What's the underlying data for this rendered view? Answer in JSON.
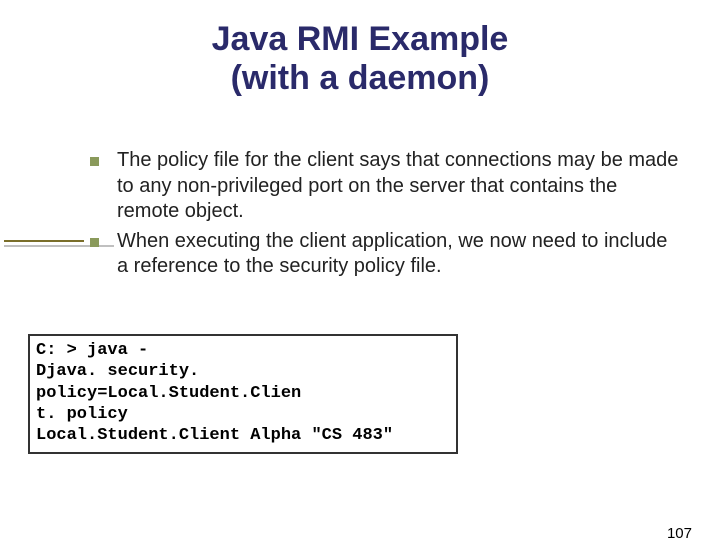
{
  "title_line1": "Java RMI Example",
  "title_line2": "(with a daemon)",
  "bullets": [
    "The policy file for the client says that connections may be made to any non-privileged port on the server that contains the remote object.",
    "When executing the client application, we now need to include a reference to the security policy file."
  ],
  "code": "C: > java -\nDjava. security. policy=Local.Student.Clien\nt. policy\nLocal.Student.Client Alpha \"CS 483\"",
  "page_number": "107"
}
